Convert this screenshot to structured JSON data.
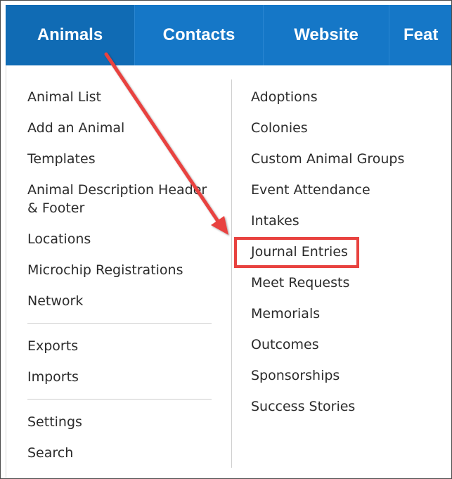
{
  "nav": {
    "tabs": [
      {
        "label": "Animals"
      },
      {
        "label": "Contacts"
      },
      {
        "label": "Website"
      },
      {
        "label": "Feat"
      }
    ]
  },
  "menu": {
    "left_column": {
      "group1": [
        "Animal List",
        "Add an Animal",
        "Templates",
        "Animal Description Header & Footer",
        "Locations",
        "Microchip Registrations",
        "Network"
      ],
      "group2": [
        "Exports",
        "Imports"
      ],
      "group3": [
        "Settings",
        "Search"
      ]
    },
    "right_column": [
      "Adoptions",
      "Colonies",
      "Custom Animal Groups",
      "Event Attendance",
      "Intakes",
      "Journal Entries",
      "Meet Requests",
      "Memorials",
      "Outcomes",
      "Sponsorships",
      "Success Stories"
    ]
  },
  "annotation": {
    "highlighted_item": "Journal Entries",
    "arrow_color": "#e8423f",
    "box_color": "#e8423f"
  },
  "colors": {
    "nav_bg": "#1577c7",
    "nav_active_bg": "#106bb4",
    "text": "#2b2b2b"
  }
}
